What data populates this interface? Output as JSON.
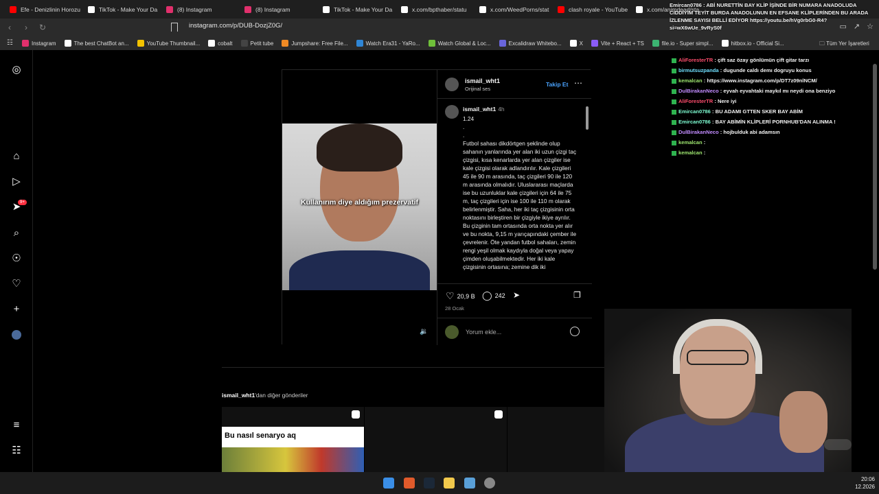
{
  "browser": {
    "tabs": [
      {
        "label": "Efe - Denizlinin Horozu",
        "icon": "youtube-icon",
        "color": "#ff0000"
      },
      {
        "label": "TikTok - Make Your Da",
        "icon": "tiktok-icon",
        "color": "#ffffff"
      },
      {
        "label": "(8) Instagram",
        "icon": "instagram-icon",
        "color": "#e1306c"
      },
      {
        "label": "(8) Instagram",
        "icon": "instagram-icon",
        "color": "#e1306c"
      },
      {
        "label": "TikTok - Make Your Da",
        "icon": "tiktok-icon",
        "color": "#ffffff"
      },
      {
        "label": "x.com/bpthaber/statu",
        "icon": "x-icon",
        "color": "#ffffff"
      },
      {
        "label": "x.com/WeedPorns/stat",
        "icon": "x-icon",
        "color": "#ffffff"
      },
      {
        "label": "clash royale - YouTube",
        "icon": "youtube-icon",
        "color": "#ff0000"
      },
      {
        "label": "x.com/animdead/sta",
        "icon": "x-icon",
        "color": "#ffffff"
      }
    ],
    "url": "instagram.com/p/DUB-DozjZ0G/",
    "bookmarks": [
      {
        "label": "Instagram",
        "color": "#e1306c"
      },
      {
        "label": "The best ChatBot an...",
        "color": "#ffffff"
      },
      {
        "label": "YouTube Thumbnail...",
        "color": "#f2c200"
      },
      {
        "label": "cobalt",
        "color": "#ffffff"
      },
      {
        "label": "Petit tube",
        "color": "#444444"
      },
      {
        "label": "Jumpshare: Free File...",
        "color": "#f08a24"
      },
      {
        "label": "Watch Era31 - YaRo...",
        "color": "#2f86d6"
      },
      {
        "label": "Watch Global & Loc...",
        "color": "#6fbf3a"
      },
      {
        "label": "Excalidraw Whitebo...",
        "color": "#6965db"
      },
      {
        "label": "X",
        "color": "#ffffff"
      },
      {
        "label": "Vite + React + TS",
        "color": "#8a5cf6"
      },
      {
        "label": "file.io - Super simpl...",
        "color": "#3cb371"
      },
      {
        "label": "hitbox.io - Official Si...",
        "color": "#ffffff"
      }
    ],
    "all_bookmarks": "Tüm Yer İşaretleri"
  },
  "post": {
    "username": "ismail_wht1",
    "audio": "Orijinal ses",
    "follow": "Takip Et",
    "comment_author": "ismail_wht1",
    "comment_time": "4h",
    "caption_text": "1.24\n.\n.\nFutbol sahası dikdörtgen şeklinde olup sahanın yanlarında yer alan iki uzun çizgi taç çizgisi, kısa kenarlarda yer alan çizgiler ise kale çizgisi olarak adlandırılır. Kale çizgileri 45 ile 90 m arasında, taç çizgileri 90 ile 120 m arasında olmalıdır. Uluslararası maçlarda ise bu uzunluklar kale çizgileri için 64 ile 75 m, taç çizgileri için ise 100 ile 110 m olarak belirlenmiştir. Saha, her iki taç çizgisinin orta noktasını birleştiren bir çizgiyle ikiye ayrılır. Bu çizginin tam ortasında orta nokta yer alır ve bu nokta, 9,15 m yarıçapındaki çember ile çevrelenir. Öte yandan futbol sahaları, zemin rengi yeşil olmak kaydıyla doğal veya yapay çimden oluşabilmektedir. Her iki kale çizgisinin ortasına; zemine dik iki",
    "video_caption": "Kullanırım diye aldığım prezervatif",
    "likes": "20,9 B",
    "comments": "242",
    "date": "28 Ocak",
    "add_comment_placeholder": "Yorum ekle...",
    "more_posts_user": "ismail_wht1",
    "more_posts_suffix": "'dan diğer gönderiler",
    "thumb1_title": "Bu nasıl senaryo aq"
  },
  "notification_badge": "9+",
  "chat": {
    "top_message": "Emircan0786 : ABİ NURETTİN BAY KLİP İŞİNDE BİR NUMARA ANADOLUDA CİDDİYİM TEYİT BURDA ANADOLUNUN EN EFSANE KLİPLERİNDEN BU ARADA İZLENME SAYISI BELLİ EDİYOR https://youtu.be/hVg0rbG0-R4?si=wX6wUe_9vRyS0f",
    "lines": [
      {
        "user": "AliForesterTR",
        "text": "çift saz özay gönlümün çift gitar tarzı",
        "color": "#ff4d6d"
      },
      {
        "user": "birmutsuzpanda",
        "text": "dugunde caldı demı dogruyu konus",
        "color": "#6fe0ff"
      },
      {
        "user": "kemalcan",
        "text": "https://www.instagram.com/p/DT7z09nlNCM/",
        "color": "#9fe870"
      },
      {
        "user": "DulBirakanNeco",
        "text": "eyvah eyvahtaki maykıl mı neydi ona benziyo",
        "color": "#c28cff"
      },
      {
        "user": "AliForesterTR",
        "text": "Nere iyi",
        "color": "#ff4d6d"
      },
      {
        "user": "Emircan0786",
        "text": "BU ADAMI GTTEN SKER BAY ABİM",
        "color": "#7fffd4"
      },
      {
        "user": "Emircan0786",
        "text": "BAY ABİMİN KLİPLERİ PORNHUB'DAN ALINMA !",
        "color": "#7fffd4"
      },
      {
        "user": "DulBirakanNeco",
        "text": "hojbulduk abi adamsın",
        "color": "#c28cff"
      },
      {
        "user": "kemalcan",
        "text": "",
        "color": "#9fe870"
      },
      {
        "user": "kemalcan",
        "text": "",
        "color": "#9fe870"
      }
    ]
  },
  "clock": {
    "time": "20:06",
    "date": "12.2026"
  }
}
